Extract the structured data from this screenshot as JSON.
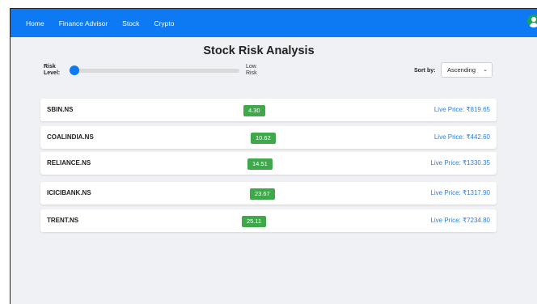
{
  "nav": {
    "items": [
      "Home",
      "Finance Advisor",
      "Stock",
      "Crypto"
    ]
  },
  "page": {
    "title": "Stock Risk Analysis"
  },
  "controls": {
    "risk_label_line1": "Risk",
    "risk_label_line2": "Level:",
    "risk_value_line1": "Low",
    "risk_value_line2": "Risk",
    "slider_fraction": 0.0,
    "sort_label": "Sort by:",
    "sort_selected": "Ascending"
  },
  "stocks": [
    {
      "symbol": "SBIN.NS",
      "risk": "4.30",
      "price": "Live Price: ₹819.65"
    },
    {
      "symbol": "COALINDIA.NS",
      "risk": "10.62",
      "price": "Live Price: ₹442.60"
    },
    {
      "symbol": "RELIANCE.NS",
      "risk": "14.51",
      "price": "Live Price: ₹1330.35"
    },
    {
      "symbol": "ICICIBANK.NS",
      "risk": "23.67",
      "price": "Live Price: ₹1317.90"
    },
    {
      "symbol": "TRENT.NS",
      "risk": "25.11",
      "price": "Live Price: ₹7234.80"
    }
  ],
  "colors": {
    "navbar": "#0d79f2",
    "badge": "#3ea84a",
    "price": "#2f7ed8",
    "avatar": "#1ea35a"
  },
  "icons": {
    "avatar": "user-avatar-icon",
    "dropdown": "chevron-down-icon"
  }
}
